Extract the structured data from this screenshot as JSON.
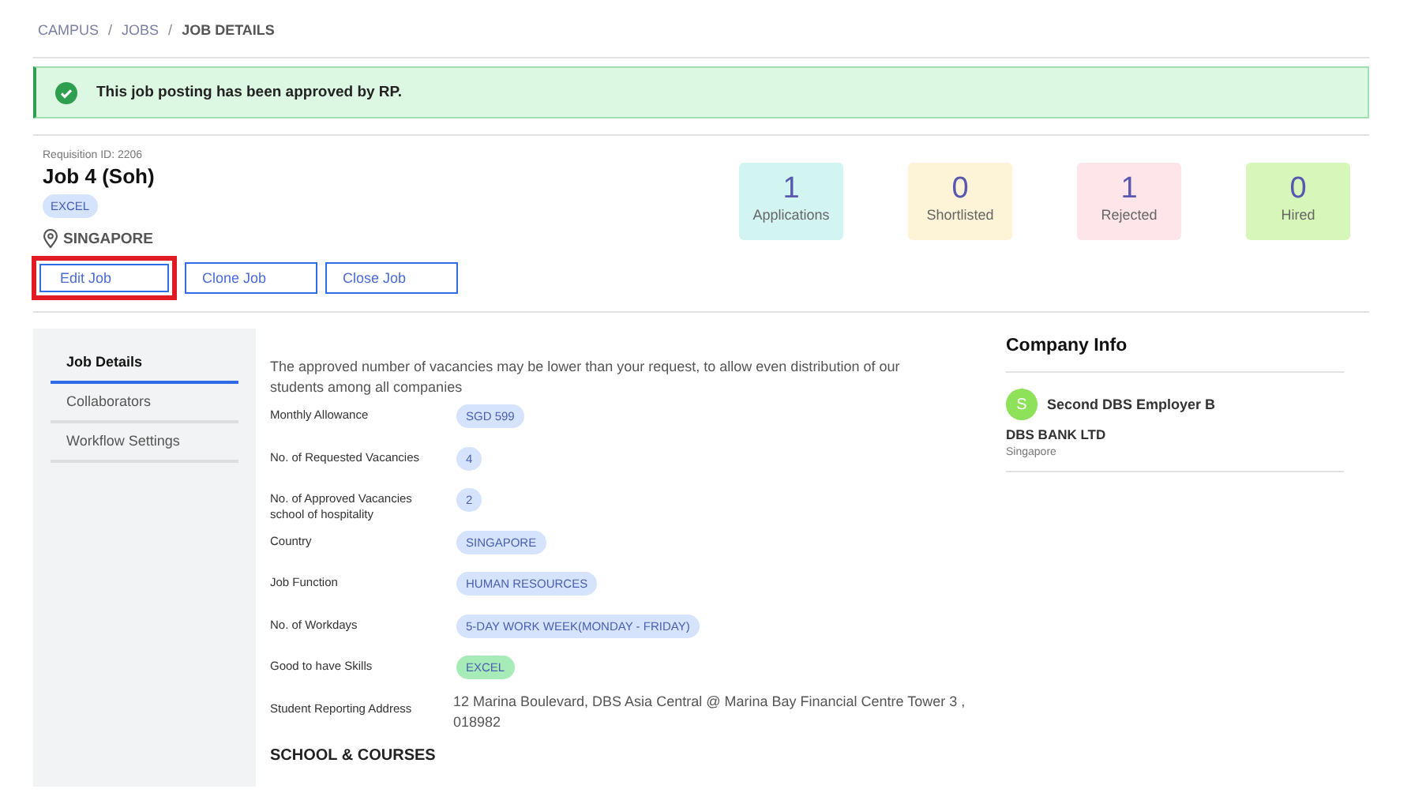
{
  "breadcrumb": [
    {
      "label": "CAMPUS",
      "current": false
    },
    {
      "separator": "/",
      "label": "JOBS",
      "current": false
    },
    {
      "separator": "/",
      "label": "JOB DETAILS",
      "current": true
    }
  ],
  "alert": {
    "message": "This job posting has been approved by RP."
  },
  "job": {
    "requisition": "Requisition ID: 2206",
    "title": "Job 4 (Soh)",
    "tag": "EXCEL",
    "location": "SINGAPORE"
  },
  "stats": [
    {
      "value": "1",
      "label": "Applications",
      "color": "#d3f5f2"
    },
    {
      "value": "0",
      "label": "Shortlisted",
      "color": "#fdf3d6"
    },
    {
      "value": "1",
      "label": "Rejected",
      "color": "#fde5ea"
    },
    {
      "value": "0",
      "label": "Hired",
      "color": "#d6f7b9"
    }
  ],
  "buttons": [
    {
      "label": "Edit Job",
      "highlighted": true
    },
    {
      "label": "Clone Job",
      "highlighted": false
    },
    {
      "label": "Close Job",
      "highlighted": false
    }
  ],
  "sidebar": {
    "items": [
      {
        "label": "Job Details",
        "selected": true
      },
      {
        "label": "Collaborators",
        "selected": false
      },
      {
        "label": "Workflow Settings",
        "selected": false
      }
    ]
  },
  "details": {
    "note": "The approved number of vacancies may be lower than your request, to allow even distribution of our students among all companies",
    "fields": [
      {
        "label": "Monthly Allowance",
        "kind": "tag",
        "value": "SGD 599",
        "color": "#d5e3fd"
      },
      {
        "label": "No. of Requested Vacancies",
        "kind": "tag",
        "value": "4",
        "color": "#d5e3fd"
      },
      {
        "label": "No. of Approved Vacancies school of hospitality",
        "kind": "tag",
        "value": "2",
        "color": "#d5e3fd"
      },
      {
        "label": "Country",
        "kind": "tag",
        "value": "SINGAPORE",
        "color": "#d5e3fd"
      },
      {
        "label": "Job Function",
        "kind": "tag",
        "value": "HUMAN RESOURCES",
        "color": "#d5e3fd"
      },
      {
        "label": "No. of Workdays",
        "kind": "tag",
        "value": "5-DAY WORK WEEK(MONDAY - FRIDAY)",
        "color": "#d5e3fd"
      },
      {
        "label": "Good to have Skills",
        "kind": "tag",
        "value": "EXCEL",
        "color": "#a6ebb8"
      },
      {
        "label": "Student Reporting Address",
        "kind": "text",
        "value": "12 Marina Boulevard, DBS Asia Central @ Marina Bay Financial Centre Tower 3 , 018982"
      }
    ],
    "section_heading": "SCHOOL & COURSES"
  },
  "company": {
    "heading": "Company Info",
    "avatar": "S",
    "employer": "Second DBS Employer B",
    "name": "DBS BANK LTD",
    "location": "Singapore"
  }
}
